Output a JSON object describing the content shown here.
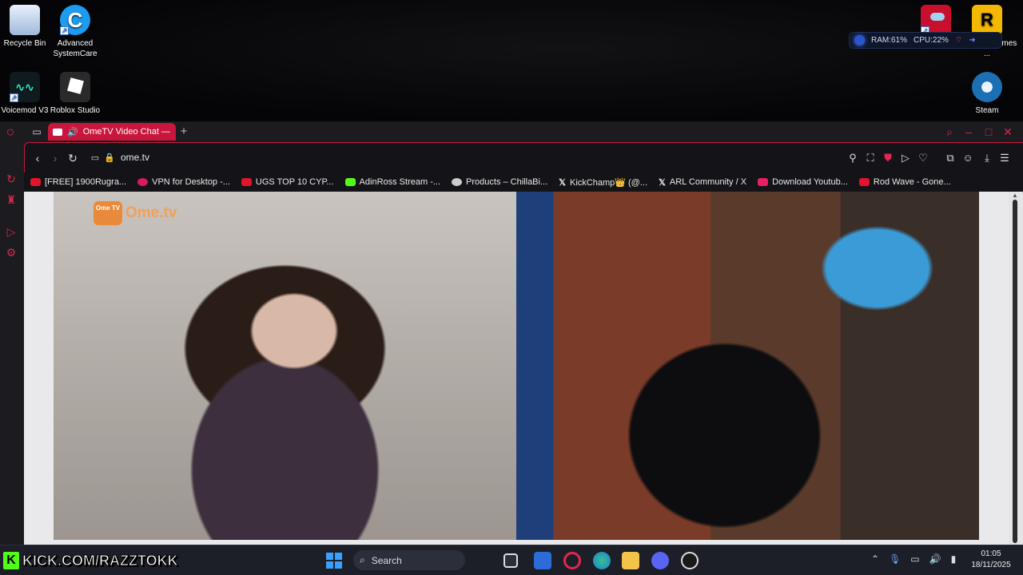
{
  "desktop": {
    "icons": [
      {
        "label": "Recycle Bin"
      },
      {
        "label": "Advanced SystemCare"
      },
      {
        "label": "Voicemod V3"
      },
      {
        "label": "Roblox Studio"
      },
      {
        "label": "Rockstar Games ..."
      },
      {
        "label": "Steam"
      }
    ],
    "sysmon": {
      "ram": "RAM:61%",
      "cpu": "CPU:22%"
    }
  },
  "browser": {
    "tab_title": "OmeTV Video Chat —",
    "url": "ome.tv",
    "bookmarks": [
      {
        "label": "[FREE] 1900Rugra...",
        "color": "#e0152b"
      },
      {
        "label": "VPN for Desktop -...",
        "color": "#d81b60"
      },
      {
        "label": "UGS TOP 10 CYP...",
        "color": "#e0152b"
      },
      {
        "label": "AdinRoss Stream -...",
        "color": "#53fc18"
      },
      {
        "label": "Products – ChillaBi...",
        "color": "#cccccc"
      },
      {
        "label": "KickChamp👑 (@...",
        "color": "#ffffff"
      },
      {
        "label": "ARL Community / X",
        "color": "#ffffff"
      },
      {
        "label": "Download Youtub...",
        "color": "#e91e63"
      },
      {
        "label": "Rod Wave - Gone...",
        "color": "#e0152b"
      }
    ],
    "accent": "#c9163d"
  },
  "ometv": {
    "logo_badge": "Ome TV",
    "logo_text": "Ome.tv"
  },
  "taskbar": {
    "overlay_text": "KICK.COM/RAZZTOKK",
    "search_label": "Search",
    "time": "01:05",
    "date": "18/11/2025"
  }
}
